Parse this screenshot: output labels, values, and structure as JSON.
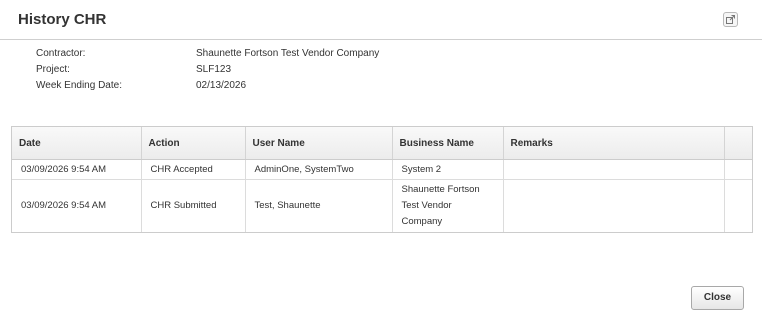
{
  "dialog": {
    "title": "History CHR",
    "close_label": "Close"
  },
  "meta": {
    "contractor_label": "Contractor:",
    "contractor_value": "Shaunette Fortson Test Vendor Company",
    "project_label": "Project:",
    "project_value": "SLF123",
    "week_label": "Week Ending Date:",
    "week_value": "02/13/2026"
  },
  "table": {
    "columns": [
      "Date",
      "Action",
      "User Name",
      "Business Name",
      "Remarks",
      ""
    ],
    "rows": [
      [
        "03/09/2026 9:54 AM",
        "CHR Accepted",
        "AdminOne, SystemTwo",
        "System 2",
        "",
        ""
      ],
      [
        "03/09/2026 9:54 AM",
        "CHR Submitted",
        "Test, Shaunette",
        "Shaunette Fortson Test Vendor Company",
        "",
        ""
      ]
    ]
  },
  "icons": {
    "popout": "popout-icon"
  }
}
